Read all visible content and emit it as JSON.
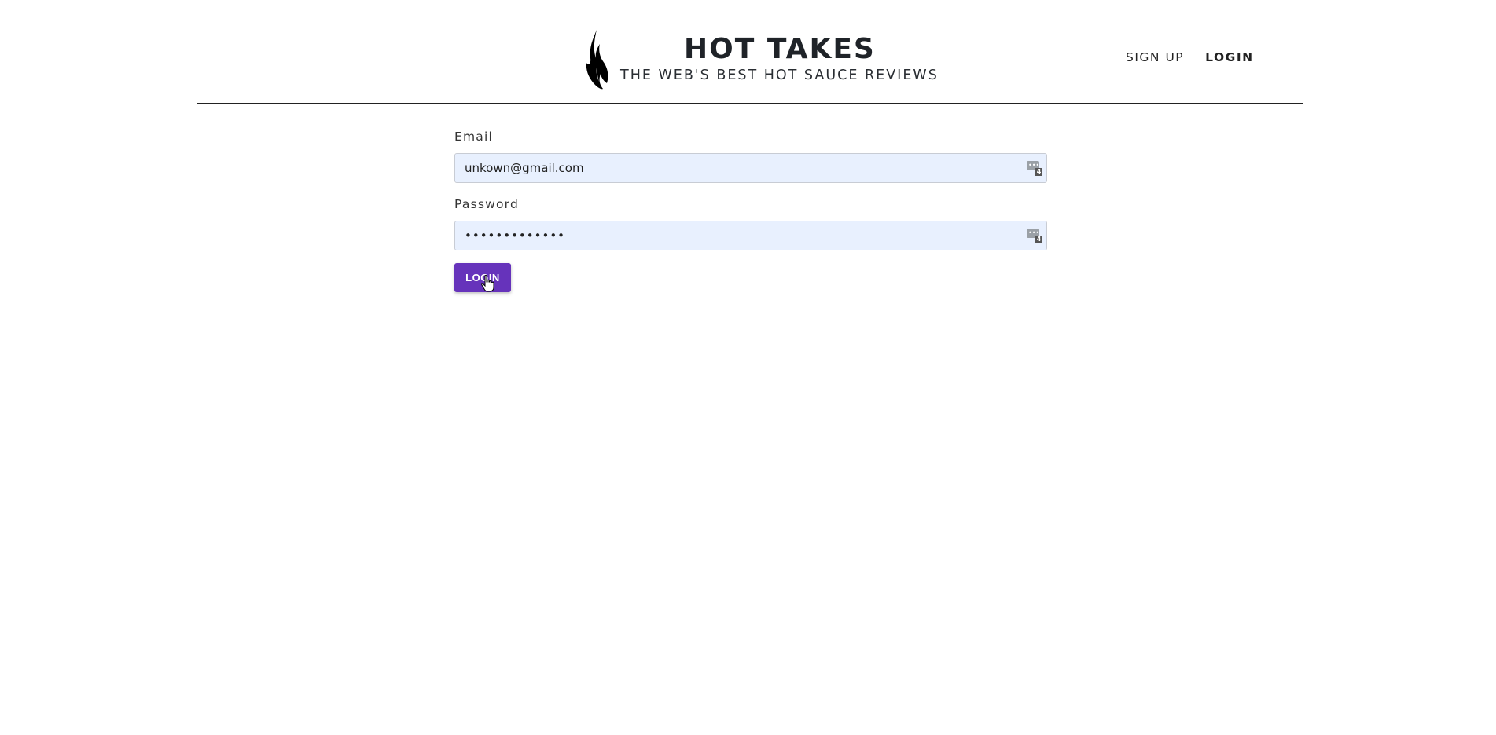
{
  "header": {
    "title": "HOT TAKES",
    "subtitle": "THE WEB'S BEST HOT SAUCE REVIEWS",
    "logo_icon": "flame-icon"
  },
  "nav": {
    "signup_label": "SIGN UP",
    "login_label": "LOGIN"
  },
  "form": {
    "email": {
      "label": "Email",
      "value": "unkown@gmail.com"
    },
    "password": {
      "label": "Password",
      "value": "•••••••••••••",
      "manager_badge": "4"
    },
    "email_manager_badge": "4",
    "submit_label": "LOGIN"
  },
  "colors": {
    "accent": "#6633bb",
    "input_bg": "#e8f0fe"
  }
}
